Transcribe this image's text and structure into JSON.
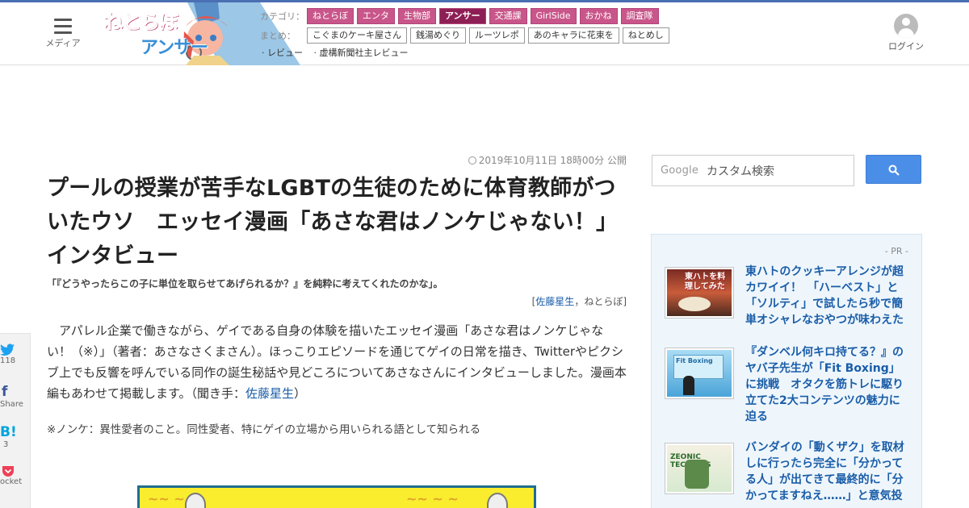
{
  "header": {
    "menu_label": "メディア",
    "logo_line1": "ねとらぼ",
    "logo_line2": "アンサー",
    "category_label": "カテゴリ：",
    "categories": [
      "ねとらぼ",
      "エンタ",
      "生物部",
      "アンサー",
      "交通課",
      "GirlSide",
      "おかね",
      "調査隊"
    ],
    "active_category": "アンサー",
    "matome_label": "まとめ：",
    "matome": [
      "こぐまのケーキ屋さん",
      "銭湯めぐり",
      "ルーツレポ",
      "あのキャラに花束を",
      "ねとめし"
    ],
    "sub_links": [
      "· レビュー",
      "· 虚構新聞社主レビュー"
    ],
    "login_label": "ログイン"
  },
  "article": {
    "pubdate": "2019年10月11日 18時00分 公開",
    "title": "プールの授業が苦手なLGBTの生徒のために体育教師がついたウソ　エッセイ漫画「あさな君はノンケじゃない！」インタビュー",
    "subtitle": "「『どうやったらこの子に単位を取らせてあげられるか？』を純粋に考えてくれたのかな」。",
    "byline_open": "[",
    "author": "佐藤星生",
    "byline_rest": "，ねとらぼ]",
    "body_main": "アパレル企業で働きながら、ゲイである自身の体験を描いたエッセイ漫画「あさな君はノンケじゃない！（※）」（著者：あさなさくまさん）。ほっこりエピソードを通じてゲイの日常を描き、Twitterやピクシブ上でも反響を呼んでいる同作の誕生秘話や見どころについてあさなさんにインタビューしました。漫画本編もあわせて掲載します。（聞き手：",
    "body_author": "佐藤星生",
    "body_close": "）",
    "note": "※ノンケ：異性愛者のこと。同性愛者、特にゲイの立場から用いられる語として知られる"
  },
  "share": {
    "twitter_count": "118",
    "facebook_label": "Share",
    "hatena_count": "3",
    "pocket_label": "ocket"
  },
  "search": {
    "google_label": "Google",
    "placeholder": "カスタム検索"
  },
  "pr": {
    "label": "- PR -",
    "items": [
      {
        "title": "東ハトのクッキーアレンジが超カワイイ！　「ハーベスト」と「ソルティ」で試したら秒で簡単オシャレなおやつが味わえた",
        "thumb_caption": "東ハトを料理してみた"
      },
      {
        "title": "『ダンベル何キロ持てる？』のヤバ子先生が「Fit Boxing」に挑戦　オタクを筋トレに駆り立てた2大コンテンツの魅力に迫る",
        "thumb_caption": "Fit Boxing"
      },
      {
        "title": "バンダイの「動くザク」を取材しに行ったら完全に「分かってる人」が出てきて最終的に「分かってますねえ……」と意気投",
        "thumb_caption": "ZEONIC TECHNICS"
      }
    ]
  },
  "colors": {
    "accent": "#4a6fb3",
    "category_tag": "#c9568a",
    "category_active": "#8e1f55",
    "link": "#1a5da8",
    "search_button": "#4a8ee8",
    "pr_background": "#eef6fc"
  }
}
